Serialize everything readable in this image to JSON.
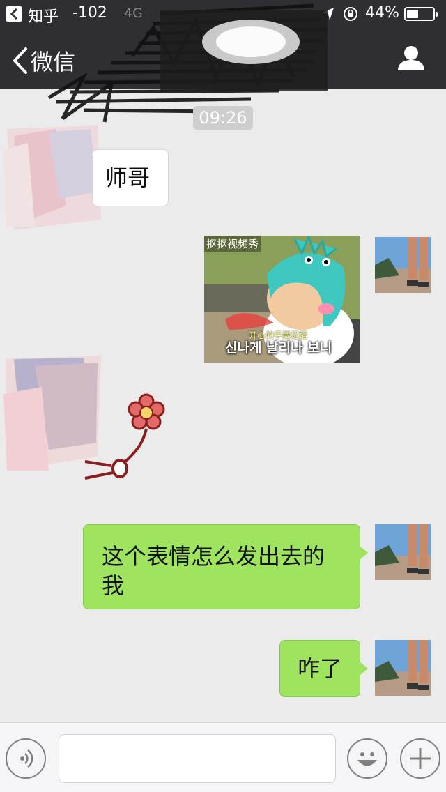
{
  "status_bar": {
    "app_name": "知乎",
    "signal_strength": "-102",
    "network": "4G",
    "battery_percent": "44%",
    "battery_level": 0.44
  },
  "nav": {
    "back_label": "微信"
  },
  "chat": {
    "time": "09:26",
    "messages": [
      {
        "from": "other",
        "type": "text",
        "text": "师哥"
      },
      {
        "from": "me",
        "type": "image",
        "watermark": "抠抠视频秀",
        "caption": "신나게 날리나 보니",
        "caption_top": "开心的手舞足蹈"
      },
      {
        "from": "other",
        "type": "sticker",
        "name": "flower-sticker"
      },
      {
        "from": "me",
        "type": "text",
        "text": "这个表情怎么发出去的我"
      },
      {
        "from": "me",
        "type": "text",
        "text": "咋了"
      }
    ]
  },
  "input_bar": {
    "placeholder": ""
  },
  "colors": {
    "nav_bg": "#2e2e33",
    "chat_bg": "#ebebeb",
    "my_bubble": "#9ee45f"
  }
}
